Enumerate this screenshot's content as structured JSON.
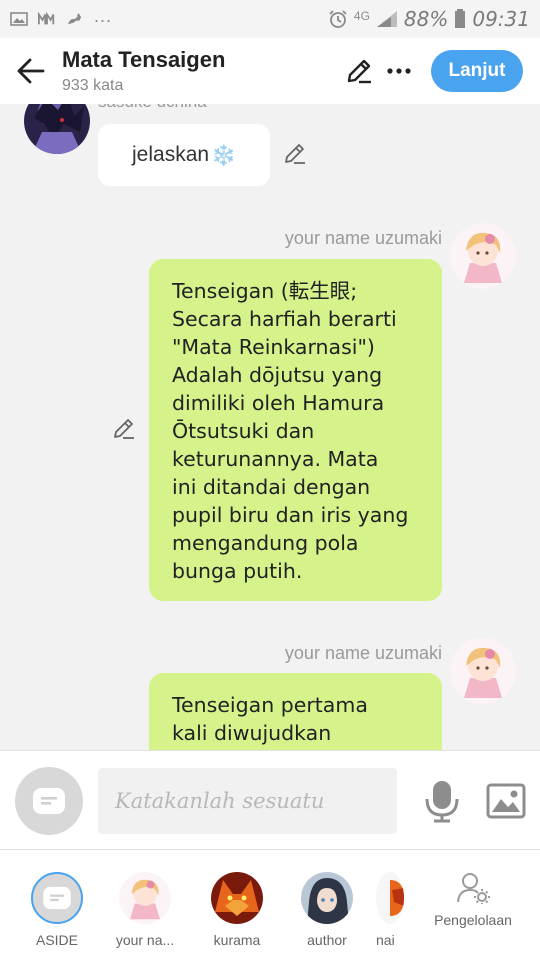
{
  "status_bar": {
    "network": "4G",
    "battery": "88%",
    "time": "09:31",
    "overflow": "..."
  },
  "header": {
    "title": "Mata Tensaigen",
    "subtitle": "933 kata",
    "next_label": "Lanjut"
  },
  "messages": [
    {
      "sender": "sasuke uchiha",
      "text": "jelaskan",
      "emoji": "❄️"
    },
    {
      "sender": "your name uzumaki",
      "text": "Tenseigan (転生眼;\nSecara harfiah berarti\n\"Mata Reinkarnasi\")\nAdalah dōjutsu yang\ndimiliki oleh Hamura\nŌtsutsuki dan\nketurunannya. Mata\nini ditandai dengan\npupil biru dan iris yang\nmengandung pola\nbunga putih."
    },
    {
      "sender": "your name uzumaki",
      "text": "Tenseigan pertama\nkali diwujudkan"
    }
  ],
  "input": {
    "placeholder": "Katakanlah sesuatu"
  },
  "characters": [
    {
      "label": "ASIDE"
    },
    {
      "label": "your na..."
    },
    {
      "label": "kurama"
    },
    {
      "label": "author"
    },
    {
      "label": "nai"
    }
  ],
  "manage_label": "Pengelolaan",
  "colors": {
    "accent": "#4aa3ee",
    "user_bubble": "#d5f38a",
    "other_bubble": "#ffffff",
    "background": "#f2f2f2"
  }
}
